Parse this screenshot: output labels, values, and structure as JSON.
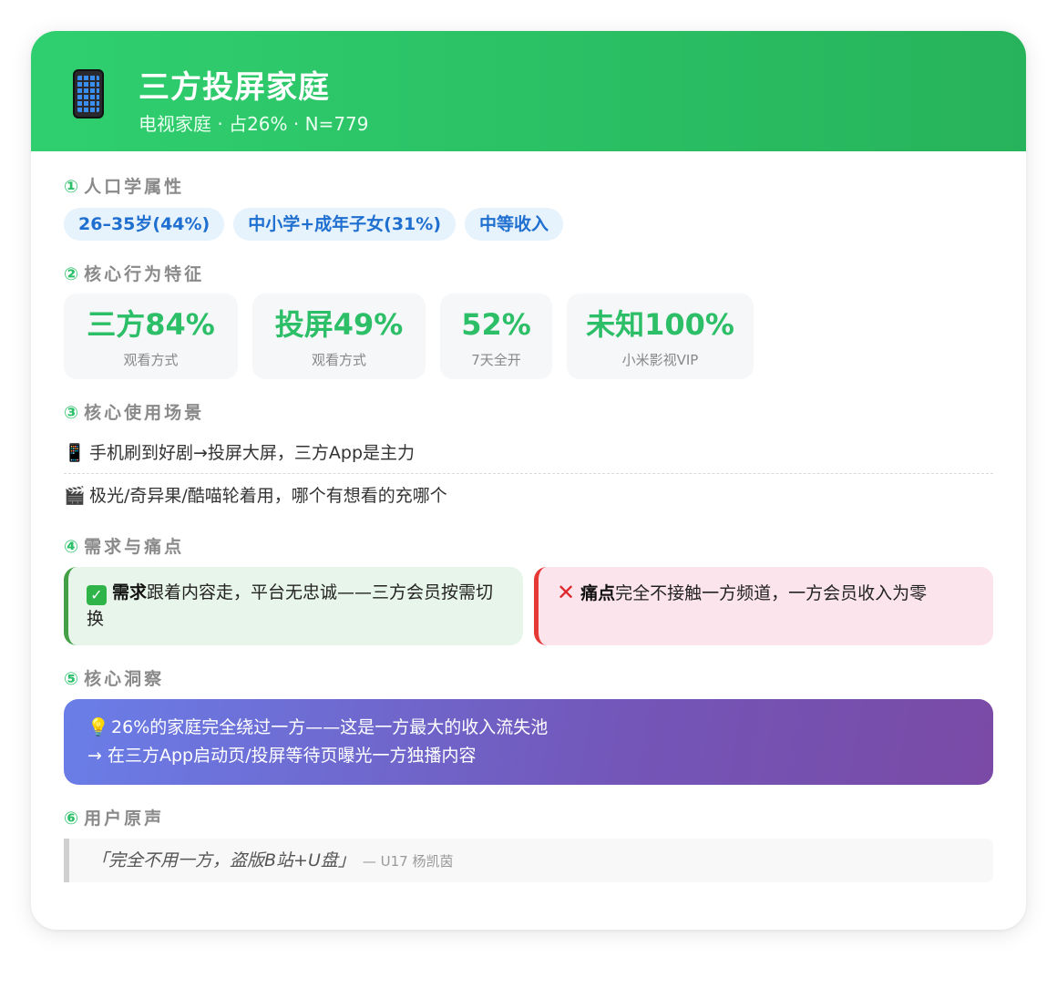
{
  "header": {
    "title": "三方投屏家庭",
    "subtitle": "电视家庭 · 占26% · N=779"
  },
  "sections": {
    "s1": {
      "num": "①",
      "title": "人口学属性"
    },
    "s2": {
      "num": "②",
      "title": "核心行为特征"
    },
    "s3": {
      "num": "③",
      "title": "核心使用场景"
    },
    "s4": {
      "num": "④",
      "title": "需求与痛点"
    },
    "s5": {
      "num": "⑤",
      "title": "核心洞察"
    },
    "s6": {
      "num": "⑥",
      "title": "用户原声"
    }
  },
  "tags": [
    "26–35岁(44%)",
    "中小学+成年子女(31%)",
    "中等收入"
  ],
  "stats": [
    {
      "value": "三方84%",
      "label": "观看方式"
    },
    {
      "value": "投屏49%",
      "label": "观看方式"
    },
    {
      "value": "52%",
      "label": "7天全开"
    },
    {
      "value": "未知100%",
      "label": "小米影视VIP"
    }
  ],
  "scenes": [
    {
      "icon": "mobile-phone-icon",
      "text": "手机刷到好剧→投屏大屏，三方App是主力"
    },
    {
      "icon": "clapper-board-icon",
      "text": "极光/奇异果/酷喵轮着用，哪个有想看的充哪个"
    }
  ],
  "needs": {
    "need_label": "需求",
    "need_text": "跟着内容走，平台无忠诚——三方会员按需切换",
    "pain_label": "痛点",
    "pain_text": "完全不接触一方频道，一方会员收入为零"
  },
  "insight": {
    "line1": "26%的家庭完全绕过一方——这是一方最大的收入流失池",
    "line2": "→ 在三方App启动页/投屏等待页曝光一方独播内容"
  },
  "quote": {
    "text": "「完全不用一方，盗版B站+U盘」",
    "who": "— U17 杨凯茵"
  },
  "colors": {
    "header_green": "#2fcf6f",
    "accent_green": "#2cbf68",
    "tag_blue": "#1e6fcf",
    "need_bg": "#e8f5ea",
    "pain_bg": "#fce4ec",
    "insight_start": "#6a7ee8",
    "insight_end": "#7a4aa6"
  }
}
